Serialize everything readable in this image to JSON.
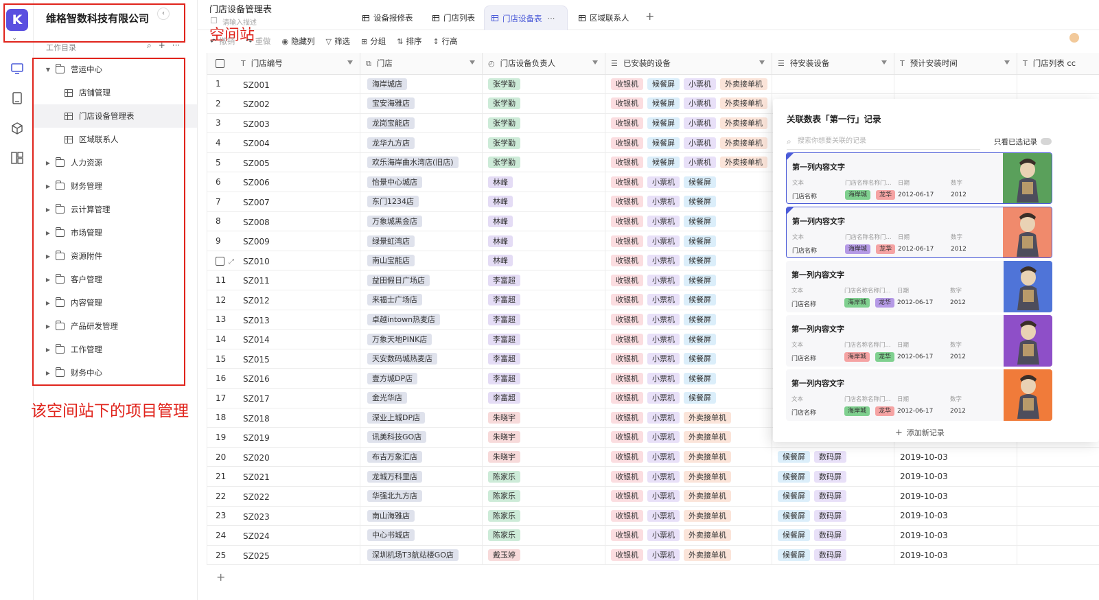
{
  "rail": {
    "logo_letter": "K",
    "items": [
      "monitor-icon",
      "book-icon",
      "cube-icon",
      "layout-icon"
    ]
  },
  "nav": {
    "company": "维格智数科技有限公司",
    "catalog_title": "工作目录",
    "tree": [
      {
        "label": "营运中心",
        "type": "folder",
        "expanded": true
      },
      {
        "label": "店铺管理",
        "type": "sheet"
      },
      {
        "label": "门店设备管理表",
        "type": "sheet",
        "selected": true
      },
      {
        "label": "区域联系人",
        "type": "sheet"
      },
      {
        "label": "人力资源",
        "type": "folder"
      },
      {
        "label": "财务管理",
        "type": "folder"
      },
      {
        "label": "云计算管理",
        "type": "folder"
      },
      {
        "label": "市场管理",
        "type": "folder"
      },
      {
        "label": "资源附件",
        "type": "folder"
      },
      {
        "label": "客户管理",
        "type": "folder"
      },
      {
        "label": "内容管理",
        "type": "folder"
      },
      {
        "label": "产品研发管理",
        "type": "folder"
      },
      {
        "label": "工作管理",
        "type": "folder"
      },
      {
        "label": "财务中心",
        "type": "folder"
      }
    ]
  },
  "annotations": {
    "space_label": "空间站",
    "project_label": "该空间站下的项目管理"
  },
  "header": {
    "title": "门店设备管理表",
    "description_placeholder": "请输入描述",
    "tabs": [
      "设备报修表",
      "门店列表",
      "门店设备表",
      "区域联系人"
    ],
    "active_tab_more": "···"
  },
  "toolbar": {
    "undo": "撤销",
    "redo": "重做",
    "hide_cols": "隐藏列",
    "filter": "筛选",
    "group": "分组",
    "sort": "排序",
    "row_height": "行高"
  },
  "table": {
    "columns": [
      "门店编号",
      "门店",
      "门店设备负责人",
      "已安装的设备",
      "待安装设备",
      "预计安装时间",
      "门店列表 cc"
    ],
    "rows": [
      {
        "n": "1",
        "code": "SZ001",
        "store": "海岸城店",
        "person": "张学勤",
        "installed": [
          "收银机",
          "候餐屏",
          "小票机",
          "外卖接单机"
        ],
        "pending": [],
        "date": ""
      },
      {
        "n": "2",
        "code": "SZ002",
        "store": "宝安海雅店",
        "person": "张学勤",
        "installed": [
          "收银机",
          "候餐屏",
          "小票机",
          "外卖接单机"
        ],
        "pending": [],
        "date": ""
      },
      {
        "n": "3",
        "code": "SZ003",
        "store": "龙岗宝能店",
        "person": "张学勤",
        "installed": [
          "收银机",
          "候餐屏",
          "小票机",
          "外卖接单机"
        ],
        "pending": [],
        "date": ""
      },
      {
        "n": "4",
        "code": "SZ004",
        "store": "龙华九方店",
        "person": "张学勤",
        "installed": [
          "收银机",
          "候餐屏",
          "小票机",
          "外卖接单机"
        ],
        "pending": [],
        "date": ""
      },
      {
        "n": "5",
        "code": "SZ005",
        "store": "欢乐海岸曲水湾店(旧店)",
        "person": "张学勤",
        "installed": [
          "收银机",
          "候餐屏",
          "小票机",
          "外卖接单机"
        ],
        "pending": [],
        "date": ""
      },
      {
        "n": "6",
        "code": "SZ006",
        "store": "怡景中心城店",
        "person": "林峰",
        "installed": [
          "收银机",
          "小票机",
          "候餐屏"
        ],
        "pending": [],
        "date": ""
      },
      {
        "n": "7",
        "code": "SZ007",
        "store": "东门1234店",
        "person": "林峰",
        "installed": [
          "收银机",
          "小票机",
          "候餐屏"
        ],
        "pending": [],
        "date": ""
      },
      {
        "n": "8",
        "code": "SZ008",
        "store": "万象城黑金店",
        "person": "林峰",
        "installed": [
          "收银机",
          "小票机",
          "候餐屏"
        ],
        "pending": [],
        "date": ""
      },
      {
        "n": "9",
        "code": "SZ009",
        "store": "绿景虹湾店",
        "person": "林峰",
        "installed": [
          "收银机",
          "小票机",
          "候餐屏"
        ],
        "pending": [],
        "date": ""
      },
      {
        "n": "",
        "code": "SZ010",
        "store": "南山宝能店",
        "person": "林峰",
        "installed": [
          "收银机",
          "小票机",
          "候餐屏"
        ],
        "pending": [],
        "date": ""
      },
      {
        "n": "11",
        "code": "SZ011",
        "store": "益田假日广场店",
        "person": "李富超",
        "installed": [
          "收银机",
          "小票机",
          "候餐屏"
        ],
        "pending": [],
        "date": ""
      },
      {
        "n": "12",
        "code": "SZ012",
        "store": "来福士广场店",
        "person": "李富超",
        "installed": [
          "收银机",
          "小票机",
          "候餐屏"
        ],
        "pending": [],
        "date": ""
      },
      {
        "n": "13",
        "code": "SZ013",
        "store": "卓越intown热麦店",
        "person": "李富超",
        "installed": [
          "收银机",
          "小票机",
          "候餐屏"
        ],
        "pending": [],
        "date": ""
      },
      {
        "n": "14",
        "code": "SZ014",
        "store": "万象天地PINK店",
        "person": "李富超",
        "installed": [
          "收银机",
          "小票机",
          "候餐屏"
        ],
        "pending": [],
        "date": ""
      },
      {
        "n": "15",
        "code": "SZ015",
        "store": "天安数码城热麦店",
        "person": "李富超",
        "installed": [
          "收银机",
          "小票机",
          "候餐屏"
        ],
        "pending": [],
        "date": ""
      },
      {
        "n": "16",
        "code": "SZ016",
        "store": "壹方城DP店",
        "person": "李富超",
        "installed": [
          "收银机",
          "小票机",
          "候餐屏"
        ],
        "pending": [],
        "date": ""
      },
      {
        "n": "17",
        "code": "SZ017",
        "store": "金光华店",
        "person": "李富超",
        "installed": [
          "收银机",
          "小票机",
          "候餐屏"
        ],
        "pending": [],
        "date": ""
      },
      {
        "n": "18",
        "code": "SZ018",
        "store": "深业上城DP店",
        "person": "朱晓宇",
        "installed": [
          "收银机",
          "小票机",
          "外卖接单机"
        ],
        "pending": [],
        "date": ""
      },
      {
        "n": "19",
        "code": "SZ019",
        "store": "讯美科技GO店",
        "person": "朱晓宇",
        "installed": [
          "收银机",
          "小票机",
          "外卖接单机"
        ],
        "pending": [],
        "date": ""
      },
      {
        "n": "20",
        "code": "SZ020",
        "store": "布吉万象汇店",
        "person": "朱晓宇",
        "installed": [
          "收银机",
          "小票机",
          "外卖接单机"
        ],
        "pending": [
          "候餐屏",
          "数码屏"
        ],
        "date": "2019-10-03"
      },
      {
        "n": "21",
        "code": "SZ021",
        "store": "龙城万科里店",
        "person": "陈家乐",
        "installed": [
          "收银机",
          "小票机",
          "外卖接单机"
        ],
        "pending": [
          "候餐屏",
          "数码屏"
        ],
        "date": "2019-10-03"
      },
      {
        "n": "22",
        "code": "SZ022",
        "store": "华强北九方店",
        "person": "陈家乐",
        "installed": [
          "收银机",
          "小票机",
          "外卖接单机"
        ],
        "pending": [
          "候餐屏",
          "数码屏"
        ],
        "date": "2019-10-03"
      },
      {
        "n": "23",
        "code": "SZ023",
        "store": "南山海雅店",
        "person": "陈家乐",
        "installed": [
          "收银机",
          "小票机",
          "外卖接单机"
        ],
        "pending": [
          "候餐屏",
          "数码屏"
        ],
        "date": "2019-10-03"
      },
      {
        "n": "24",
        "code": "SZ024",
        "store": "中心书城店",
        "person": "陈家乐",
        "installed": [
          "收银机",
          "小票机",
          "外卖接单机"
        ],
        "pending": [
          "候餐屏",
          "数码屏"
        ],
        "date": "2019-10-03"
      },
      {
        "n": "25",
        "code": "SZ025",
        "store": "深圳机场T3航站楼GO店",
        "person": "戴玉婷",
        "installed": [
          "收银机",
          "小票机",
          "外卖接单机"
        ],
        "pending": [
          "候餐屏",
          "数码屏"
        ],
        "date": "2019-10-03"
      }
    ]
  },
  "popup": {
    "title": "关联数表「第一行」记录",
    "search_placeholder": "搜索你想要关联的记录",
    "only_selected": "只看已选记录",
    "add_record": "添加新记录",
    "cards": [
      {
        "title": "第一列内容文字",
        "selected": true,
        "img_color": "#5aa05b",
        "tag1": "海岸城",
        "tag2": "龙华",
        "tag1_color": "#7fd08f",
        "tag2_color": "#f5a3a3"
      },
      {
        "title": "第一列内容文字",
        "selected": true,
        "img_color": "#f08a6c",
        "tag1": "海岸城",
        "tag2": "龙华",
        "tag1_color": "#b59ae6",
        "tag2_color": "#f5a3a3"
      },
      {
        "title": "第一列内容文字",
        "selected": false,
        "img_color": "#4f74d8",
        "tag1": "海岸城",
        "tag2": "龙华",
        "tag1_color": "#7fd08f",
        "tag2_color": "#b59ae6"
      },
      {
        "title": "第一列内容文字",
        "selected": false,
        "img_color": "#8e4fc8",
        "tag1": "海岸城",
        "tag2": "龙华",
        "tag1_color": "#f5a3a3",
        "tag2_color": "#7fd08f"
      },
      {
        "title": "第一列内容文字",
        "selected": false,
        "img_color": "#f07b3a",
        "tag1": "海岸城",
        "tag2": "龙华",
        "tag1_color": "#7fd08f",
        "tag2_color": "#f5a3a3"
      }
    ],
    "card_labels": {
      "text": "文本",
      "store_name_fields": "门店名称名称门...",
      "date": "日期",
      "number": "数字",
      "store_name": "门店名称",
      "date_value": "2012-06-17",
      "number_value": "2012"
    }
  },
  "colors": {
    "accent": "#4b5bd8",
    "annotation": "#e0231b"
  }
}
